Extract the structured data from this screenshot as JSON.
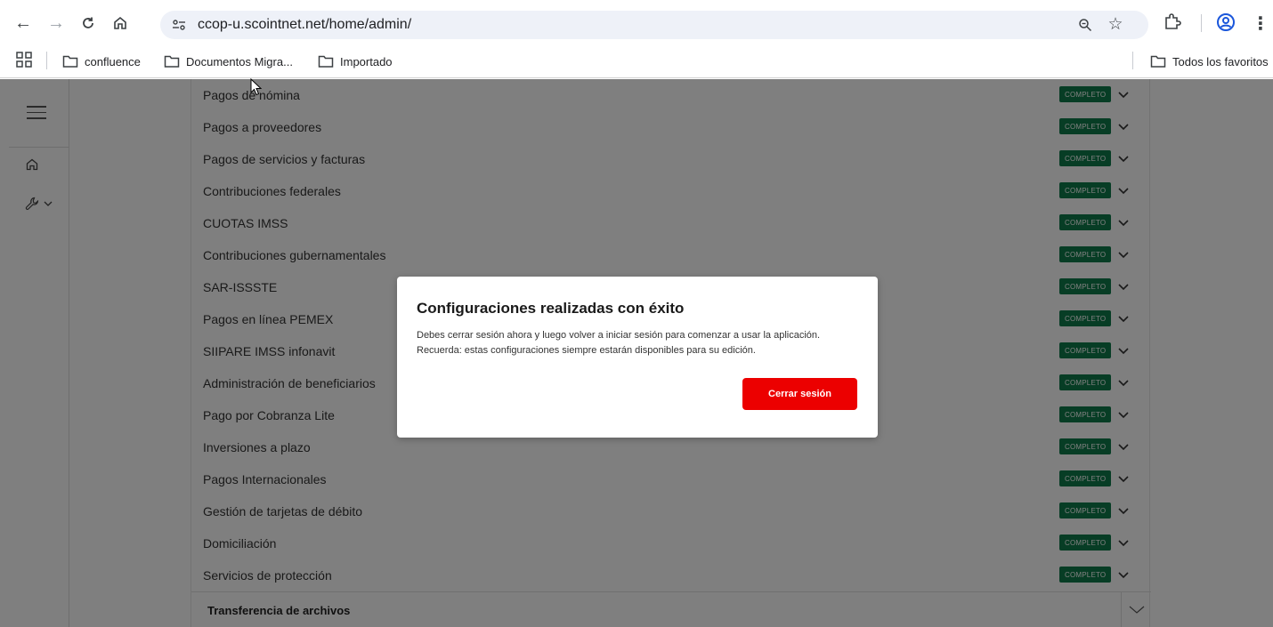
{
  "browser": {
    "url": "ccop-u.scointnet.net/home/admin/",
    "bookmarks": [
      "confluence",
      "Documentos Migra...",
      "Importado"
    ],
    "all_bookmarks": "Todos los favoritos"
  },
  "services": {
    "status_label": "COMPLETO",
    "rows": [
      "Pagos de nómina",
      "Pagos a proveedores",
      "Pagos de servicios y facturas",
      "Contribuciones federales",
      "CUOTAS IMSS",
      "Contribuciones gubernamentales",
      "SAR-ISSSTE",
      "Pagos en línea PEMEX",
      "SIIPARE IMSS infonavit",
      "Administración de beneficiarios",
      "Pago por Cobranza Lite",
      "Inversiones a plazo",
      "Pagos Internacionales",
      "Gestión de tarjetas de débito",
      "Domiciliación",
      "Servicios de protección"
    ],
    "footer_section": "Transferencia de archivos"
  },
  "modal": {
    "title": "Configuraciones realizadas con éxito",
    "line1": "Debes cerrar sesión ahora y luego volver a iniciar sesión para comenzar a usar la aplicación.",
    "line2": "Recuerda: estas configuraciones siempre estarán disponibles para su edición.",
    "button": "Cerrar sesión"
  },
  "colors": {
    "badge": "#0f7b4a",
    "primary_button": "#ec0000",
    "overlay": "rgba(0,0,0,0.5)"
  }
}
